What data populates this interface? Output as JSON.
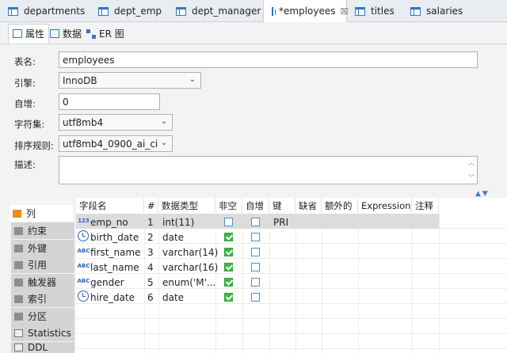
{
  "tabs": [
    {
      "label": "departments"
    },
    {
      "label": "dept_emp"
    },
    {
      "label": "dept_manager"
    },
    {
      "label": "*employees"
    },
    {
      "label": "titles"
    },
    {
      "label": "salaries"
    }
  ],
  "tab_close": "☒",
  "subtabs": [
    {
      "label": "属性"
    },
    {
      "label": "数据"
    },
    {
      "label": "ER 图"
    }
  ],
  "form": {
    "table_name_label": "表名:",
    "table_name": "employees",
    "engine_label": "引擎:",
    "engine": "InnoDB",
    "auto_inc_label": "自增:",
    "auto_inc": "0",
    "charset_label": "字符集:",
    "charset": "utf8mb4",
    "collation_label": "排序规则:",
    "collation": "utf8mb4_0900_ai_ci",
    "comment_label": "描述:",
    "comment": ""
  },
  "nav": [
    {
      "label": "列"
    },
    {
      "label": "约束"
    },
    {
      "label": "外键"
    },
    {
      "label": "引用"
    },
    {
      "label": "触发器"
    },
    {
      "label": "索引"
    },
    {
      "label": "分区"
    },
    {
      "label": "Statistics"
    },
    {
      "label": "DDL"
    }
  ],
  "columns_header": {
    "name": "字段名",
    "num": "#",
    "type": "数据类型",
    "not_null": "非空",
    "auto_inc": "自增",
    "key": "键",
    "default": "缺省",
    "extra": "额外的",
    "expression": "Expression",
    "comment": "注释"
  },
  "rows": [
    {
      "icon": "123",
      "name": "emp_no",
      "num": "1",
      "type": "int(11)",
      "not_null": false,
      "auto_inc": false,
      "key": "PRI"
    },
    {
      "icon": "clock",
      "name": "birth_date",
      "num": "2",
      "type": "date",
      "not_null": true,
      "auto_inc": false,
      "key": ""
    },
    {
      "icon": "ABC",
      "name": "first_name",
      "num": "3",
      "type": "varchar(14)",
      "not_null": true,
      "auto_inc": false,
      "key": ""
    },
    {
      "icon": "ABC",
      "name": "last_name",
      "num": "4",
      "type": "varchar(16)",
      "not_null": true,
      "auto_inc": false,
      "key": ""
    },
    {
      "icon": "ABC",
      "name": "gender",
      "num": "5",
      "type": "enum('M'...",
      "not_null": true,
      "auto_inc": false,
      "key": ""
    },
    {
      "icon": "clock",
      "name": "hire_date",
      "num": "6",
      "type": "date",
      "not_null": true,
      "auto_inc": false,
      "key": ""
    }
  ]
}
